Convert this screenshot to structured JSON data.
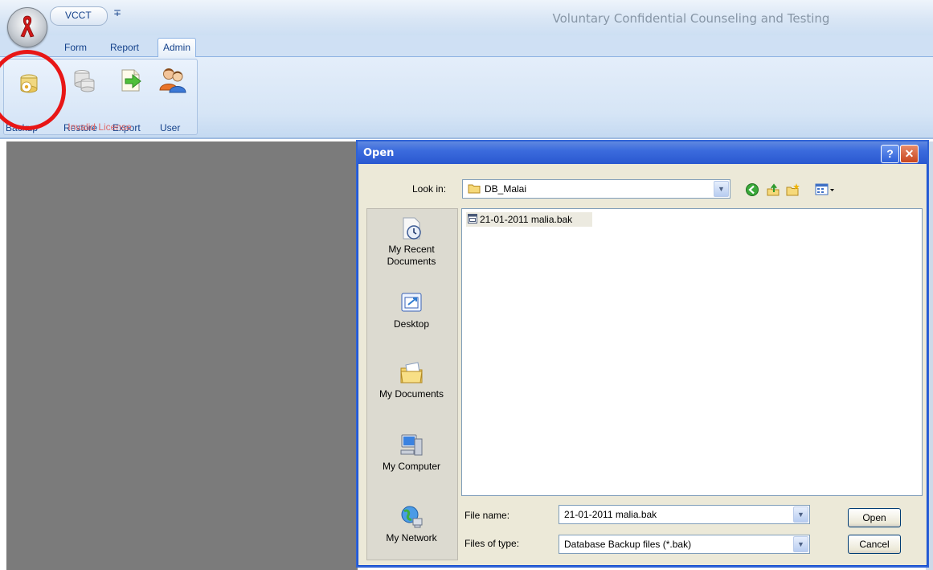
{
  "app": {
    "qat_label": "VCCT",
    "qat_dropdown": "∓",
    "window_title": "Voluntary Confidential Counseling and Testing"
  },
  "ribbon": {
    "tabs": [
      {
        "label": "Form"
      },
      {
        "label": "Report"
      },
      {
        "label": "Admin",
        "selected": true
      }
    ],
    "group_label": "Invalid License",
    "buttons": [
      {
        "label": "Backup",
        "icon": "backup-disk-icon"
      },
      {
        "label": "Restore",
        "icon": "restore-database-icon"
      },
      {
        "label": "Export",
        "icon": "export-arrow-icon"
      },
      {
        "label": "User",
        "icon": "users-icon"
      }
    ]
  },
  "dialog": {
    "title": "Open",
    "help_glyph": "?",
    "close_glyph": "✕",
    "look_in_label": "Look in:",
    "look_in_value": "DB_Malai",
    "places": [
      {
        "label": "My Recent Documents",
        "icon": "recent-documents-icon"
      },
      {
        "label": "Desktop",
        "icon": "desktop-icon"
      },
      {
        "label": "My Documents",
        "icon": "my-documents-icon"
      },
      {
        "label": "My Computer",
        "icon": "my-computer-icon"
      },
      {
        "label": "My Network",
        "icon": "my-network-icon"
      }
    ],
    "files": [
      {
        "name": "21-01-2011 malia.bak",
        "selected": true
      }
    ],
    "file_name_label": "File name:",
    "file_name_value": "21-01-2011 malia.bak",
    "file_type_label": "Files of type:",
    "file_type_value": "Database Backup files (*.bak)",
    "open_label": "Open",
    "cancel_label": "Cancel"
  },
  "colors": {
    "title_text": "#8796a6",
    "tab_text": "#15428b",
    "group_label": "#e06a6a",
    "highlight_circle": "#e81616",
    "workspace": "#7b7b7b",
    "dialog_titlebar": "#3b6bdd",
    "dialog_body": "#ece9d8"
  }
}
